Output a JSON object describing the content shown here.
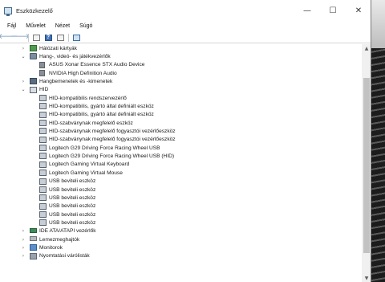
{
  "window": {
    "title": "Eszközkezelő",
    "controls": {
      "minimize": "—",
      "maximize": "☐",
      "close": "✕"
    }
  },
  "menu": [
    "Fájl",
    "Művelet",
    "Nézet",
    "Súgó"
  ],
  "toolbar": {
    "back": "🡐",
    "forward": "🡒",
    "help": "?",
    "icons": [
      "back-icon",
      "forward-icon",
      "properties-icon",
      "help-icon",
      "view-icon",
      "scan-hardware-icon"
    ]
  },
  "tree": {
    "rows": [
      {
        "level": 1,
        "expander": ">",
        "icon": "network-adapter-icon",
        "label": "Hálózati kártyák"
      },
      {
        "level": 1,
        "expander": "v",
        "icon": "sound-controller-icon",
        "label": "Hang-, videó- és játékvezérlők"
      },
      {
        "level": 2,
        "expander": "",
        "icon": "speaker-icon",
        "label": "ASUS Xonar Essence STX Audio Device"
      },
      {
        "level": 2,
        "expander": "",
        "icon": "speaker-icon",
        "label": "NVIDIA High Definition Audio"
      },
      {
        "level": 1,
        "expander": ">",
        "icon": "audio-io-icon",
        "label": "Hangbemenetek és -kimenetek"
      },
      {
        "level": 1,
        "expander": "v",
        "icon": "hid-icon",
        "label": "HID"
      },
      {
        "level": 2,
        "expander": "",
        "icon": "hid-device-icon",
        "label": "HID-kompatibilis rendszervezérlő"
      },
      {
        "level": 2,
        "expander": "",
        "icon": "hid-device-icon",
        "label": "HID-kompatibilis, gyártó által definiált eszköz"
      },
      {
        "level": 2,
        "expander": "",
        "icon": "hid-device-icon",
        "label": "HID-kompatibilis, gyártó által definiált eszköz"
      },
      {
        "level": 2,
        "expander": "",
        "icon": "hid-device-icon",
        "label": "HID-szabványnak megfelelő eszköz"
      },
      {
        "level": 2,
        "expander": "",
        "icon": "hid-device-icon",
        "label": "HID-szabványnak megfelelő fogyasztói vezérlőeszköz"
      },
      {
        "level": 2,
        "expander": "",
        "icon": "hid-device-icon",
        "label": "HID-szabványnak megfelelő fogyasztói vezérlőeszköz"
      },
      {
        "level": 2,
        "expander": "",
        "icon": "hid-device-icon",
        "label": "Logitech G29 Driving Force Racing Wheel USB"
      },
      {
        "level": 2,
        "expander": "",
        "icon": "hid-device-icon",
        "label": "Logitech G29 Driving Force Racing Wheel USB (HID)"
      },
      {
        "level": 2,
        "expander": "",
        "icon": "hid-device-icon",
        "label": "Logitech Gaming Virtual Keyboard"
      },
      {
        "level": 2,
        "expander": "",
        "icon": "hid-device-icon",
        "label": "Logitech Gaming Virtual Mouse"
      },
      {
        "level": 2,
        "expander": "",
        "icon": "hid-device-icon",
        "label": "USB beviteli eszköz"
      },
      {
        "level": 2,
        "expander": "",
        "icon": "hid-device-icon",
        "label": "USB beviteli eszköz"
      },
      {
        "level": 2,
        "expander": "",
        "icon": "hid-device-icon",
        "label": "USB beviteli eszköz"
      },
      {
        "level": 2,
        "expander": "",
        "icon": "hid-device-icon",
        "label": "USB beviteli eszköz"
      },
      {
        "level": 2,
        "expander": "",
        "icon": "hid-device-icon",
        "label": "USB beviteli eszköz"
      },
      {
        "level": 2,
        "expander": "",
        "icon": "hid-device-icon",
        "label": "USB beviteli eszköz"
      },
      {
        "level": 1,
        "expander": ">",
        "icon": "ide-controller-icon",
        "label": "IDE ATA/ATAPI vezérlők"
      },
      {
        "level": 1,
        "expander": ">",
        "icon": "disk-drive-icon",
        "label": "Lemezmeghajtók"
      },
      {
        "level": 1,
        "expander": ">",
        "icon": "monitor-icon",
        "label": "Monitorok"
      },
      {
        "level": 1,
        "expander": ">",
        "icon": "printer-queue-icon",
        "label": "Nyomtatási várólisták"
      }
    ]
  },
  "scrollbar": {
    "up": "▲",
    "down": "▼"
  }
}
